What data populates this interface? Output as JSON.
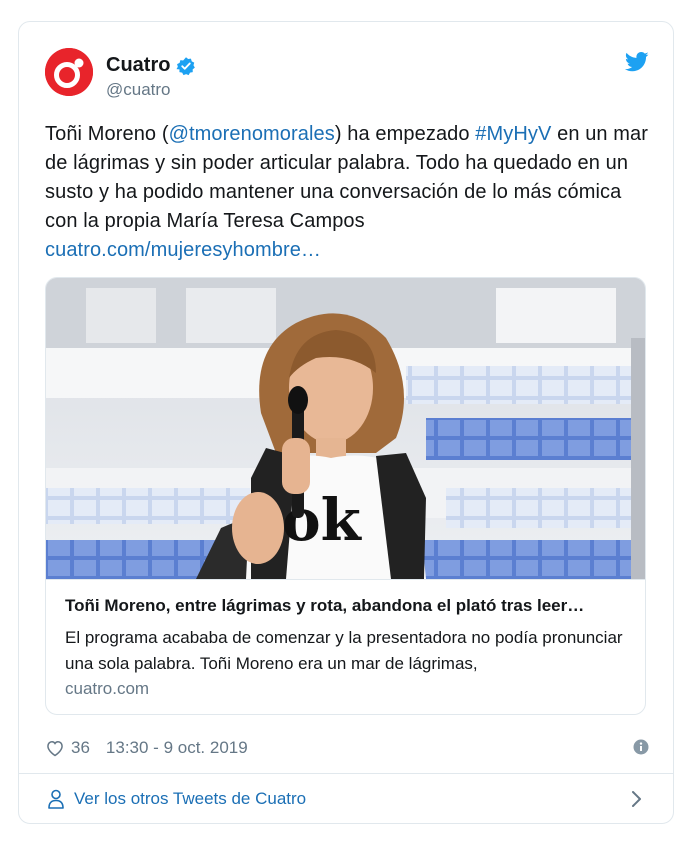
{
  "account": {
    "display_name": "Cuatro",
    "handle": "@cuatro"
  },
  "icons": {
    "avatar": "cuatro-logo",
    "verified": "verified-badge-icon",
    "brand": "twitter-bird-icon",
    "like": "heart-icon",
    "info": "info-icon",
    "profile": "person-icon",
    "next": "chevron-right-icon"
  },
  "colors": {
    "brand_red": "#e8242b",
    "link": "#1b6fb5",
    "twitter_blue": "#1da1f2",
    "muted": "#657786"
  },
  "tweet": {
    "text_part1": "Toñi Moreno (",
    "mention": "@tmorenomorales",
    "text_part2": ") ha empezado ",
    "hashtag": "#MyHyV",
    "text_part3": " en un mar de lágrimas y sin poder articular palabra. Todo ha quedado en un susto y ha podido mantener una conversación de lo más cómica con la propia María Teresa Campos",
    "link": "cuatro.com/mujeresyhombre…"
  },
  "card": {
    "image_alt": "Toñi Moreno con micrófono en el plató",
    "shirt_text": "ok",
    "title": "Toñi Moreno, entre lágrimas y rota, abandona el plató tras leer…",
    "description": "El programa acababa de comenzar y la presentadora no podía pronunciar una sola palabra. Toñi Moreno era un mar de lágrimas,",
    "domain": "cuatro.com"
  },
  "meta": {
    "likes": "36",
    "timestamp": "13:30 - 9 oct. 2019"
  },
  "footer": {
    "label": "Ver los otros Tweets de Cuatro"
  }
}
